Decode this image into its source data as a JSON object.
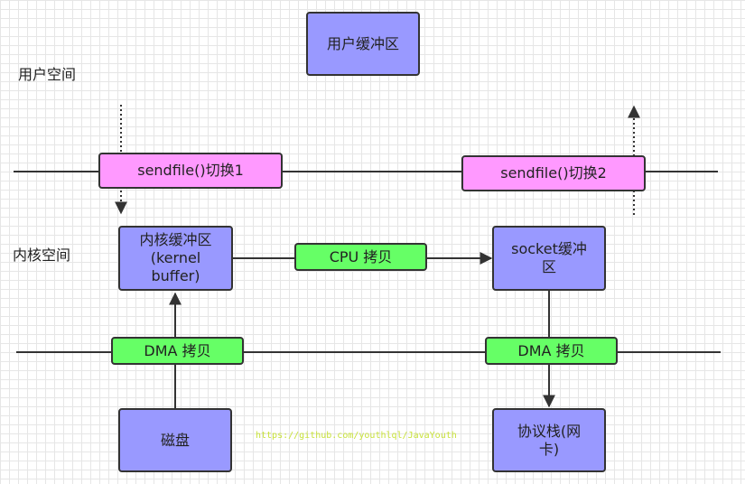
{
  "labels": {
    "user_space": "用户空间",
    "kernel_space": "内核空间"
  },
  "nodes": {
    "user_buffer": "用户缓冲区",
    "switch1": "sendfile()切换1",
    "switch2": "sendfile()切换2",
    "kernel_buffer": [
      "内核缓冲区",
      "(kernel",
      "buffer)"
    ],
    "cpu_copy": "CPU 拷贝",
    "socket_buffer": [
      "socket缓冲",
      "区"
    ],
    "dma_copy_left": "DMA 拷贝",
    "dma_copy_right": "DMA 拷贝",
    "disk": "磁盘",
    "protocol_stack": [
      "协议栈(网",
      "卡)"
    ]
  },
  "watermark": "https://github.com/youthlql/JavaYouth",
  "colors": {
    "storage_fill": "#9999ff",
    "switch_fill": "#ff99ff",
    "copy_fill": "#66ff66",
    "line": "#333333",
    "watermark": "#c8e23a"
  }
}
